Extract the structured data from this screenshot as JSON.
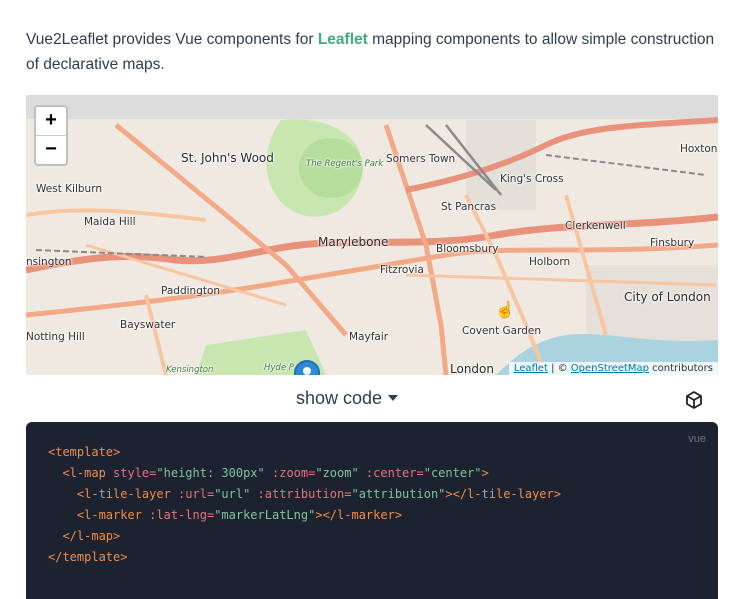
{
  "intro": {
    "before": "Vue2Leaflet provides Vue components for ",
    "link": "Leaflet",
    "after": " mapping components to allow simple construction of declarative maps."
  },
  "map": {
    "zoom_in": "+",
    "zoom_out": "−",
    "labels": {
      "st_johns_wood": "St. John's Wood",
      "regents_park": "The Regent's Park",
      "somers_town": "Somers Town",
      "kings_cross": "King's Cross",
      "hoxton": "Hoxton",
      "west_kilburn": "West Kilburn",
      "maida_hill": "Maida Hill",
      "st_pancras": "St Pancras",
      "clerkenwell": "Clerkenwell",
      "finsbury": "Finsbury",
      "marylebone": "Marylebone",
      "bloomsbury": "Bloomsbury",
      "kensington_left": "nsington",
      "fitzrovia": "Fitzrovia",
      "holborn": "Holborn",
      "paddington": "Paddington",
      "city_of_london": "City of London",
      "bayswater": "Bayswater",
      "notting_hill": "Notting Hill",
      "mayfair": "Mayfair",
      "covent_garden": "Covent Garden",
      "london": "London",
      "kensington_park": "Kensington",
      "hyde_park": "Hyde P"
    },
    "attribution": {
      "leaflet": "Leaflet",
      "separator": " | © ",
      "osm": "OpenStreetMap",
      "contributors": " contributors"
    }
  },
  "toggle": {
    "label": "show code"
  },
  "code": {
    "lang": "vue",
    "l1_open": "<template>",
    "l2_tag": "<l-map",
    "l2_a1": " style=",
    "l2_v1": "\"height: 300px\"",
    "l2_a2": " :zoom=",
    "l2_v2": "\"zoom\"",
    "l2_a3": " :center=",
    "l2_v3": "\"center\"",
    "l2_close": ">",
    "l3_tag": "<l-tile-layer",
    "l3_a1": " :url=",
    "l3_v1": "\"url\"",
    "l3_a2": " :attribution=",
    "l3_v2": "\"attribution\"",
    "l3_close": "></l-tile-layer>",
    "l4_tag": "<l-marker",
    "l4_a1": " :lat-lng=",
    "l4_v1": "\"markerLatLng\"",
    "l4_close": "></l-marker>",
    "l5": "</l-map>",
    "l6": "</template>"
  },
  "colors": {
    "accent": "#3eaf7c",
    "code_bg": "#1c2230",
    "leaflet_link": "#0078a8"
  }
}
